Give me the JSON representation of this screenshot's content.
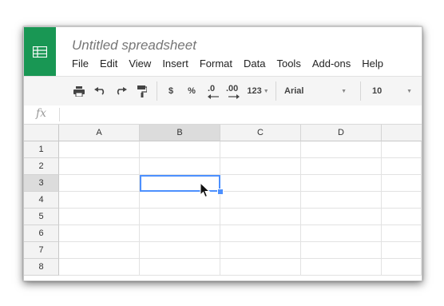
{
  "document": {
    "title": "Untitled spreadsheet"
  },
  "app_icon": {
    "name": "sheets-icon",
    "color": "#199754"
  },
  "menu": [
    {
      "label": "File"
    },
    {
      "label": "Edit"
    },
    {
      "label": "View"
    },
    {
      "label": "Insert"
    },
    {
      "label": "Format"
    },
    {
      "label": "Data"
    },
    {
      "label": "Tools"
    },
    {
      "label": "Add-ons"
    },
    {
      "label": "Help"
    }
  ],
  "toolbar": {
    "icons": [
      "print-icon",
      "undo-icon",
      "redo-icon",
      "paint-format-icon"
    ],
    "currency_label": "$",
    "percent_label": "%",
    "decrease_decimal_label": ".0",
    "increase_decimal_label": ".00",
    "more_formats_label": "123",
    "font_family": "Arial",
    "font_size": "10"
  },
  "formula_bar": {
    "fx_label": "fx",
    "value": ""
  },
  "grid": {
    "columns": [
      "A",
      "B",
      "C",
      "D"
    ],
    "rows": [
      "1",
      "2",
      "3",
      "4",
      "5",
      "6",
      "7",
      "8"
    ],
    "selected_column": "B",
    "selected_row": "3",
    "active_cell": "B3",
    "selection_color": "#4d90fe"
  }
}
